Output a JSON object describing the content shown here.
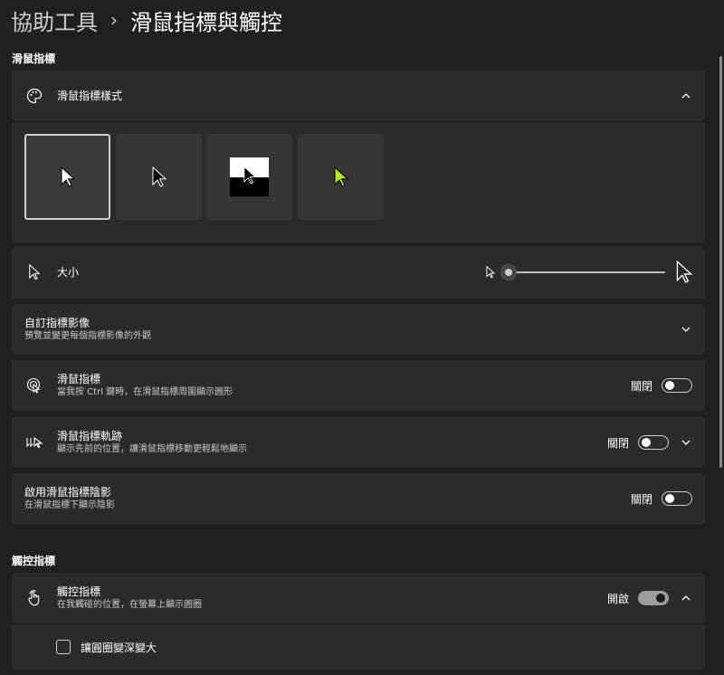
{
  "header": {
    "parent": "協助工具",
    "separator": "›",
    "current": "滑鼠指標與觸控"
  },
  "mouse_section": {
    "label": "滑鼠指標",
    "style_card": {
      "title": "滑鼠指標樣式",
      "icon": "palette-icon"
    },
    "styles": [
      {
        "name": "white",
        "selected": true
      },
      {
        "name": "black",
        "selected": false
      },
      {
        "name": "inverted",
        "selected": false
      },
      {
        "name": "custom",
        "selected": false,
        "color": "#b8e62e"
      }
    ],
    "size_card": {
      "title": "大小",
      "slider_value": 0
    },
    "custom_card": {
      "title": "自訂指標影像",
      "subtitle": "預覽並變更每個指標影像的外觀"
    },
    "indicator_card": {
      "title": "滑鼠指標",
      "subtitle": "當我按 Ctrl 鍵時，在滑鼠指標周圍顯示圓形",
      "state": "關閉"
    },
    "trails_card": {
      "title": "滑鼠指標軌跡",
      "subtitle": "顯示先前的位置，讓滑鼠指標移動更輕鬆地顯示",
      "state": "關閉"
    },
    "shadow_card": {
      "title": "啟用滑鼠指標陰影",
      "subtitle": "在滑鼠指標下顯示陰影",
      "state": "關閉"
    }
  },
  "touch_section": {
    "label": "觸控指標",
    "touch_card": {
      "title": "觸控指標",
      "subtitle": "在我觸碰的位置，在螢幕上顯示圓圈",
      "state": "開啟"
    },
    "checkbox_label": "讓圓圈變深變大"
  }
}
